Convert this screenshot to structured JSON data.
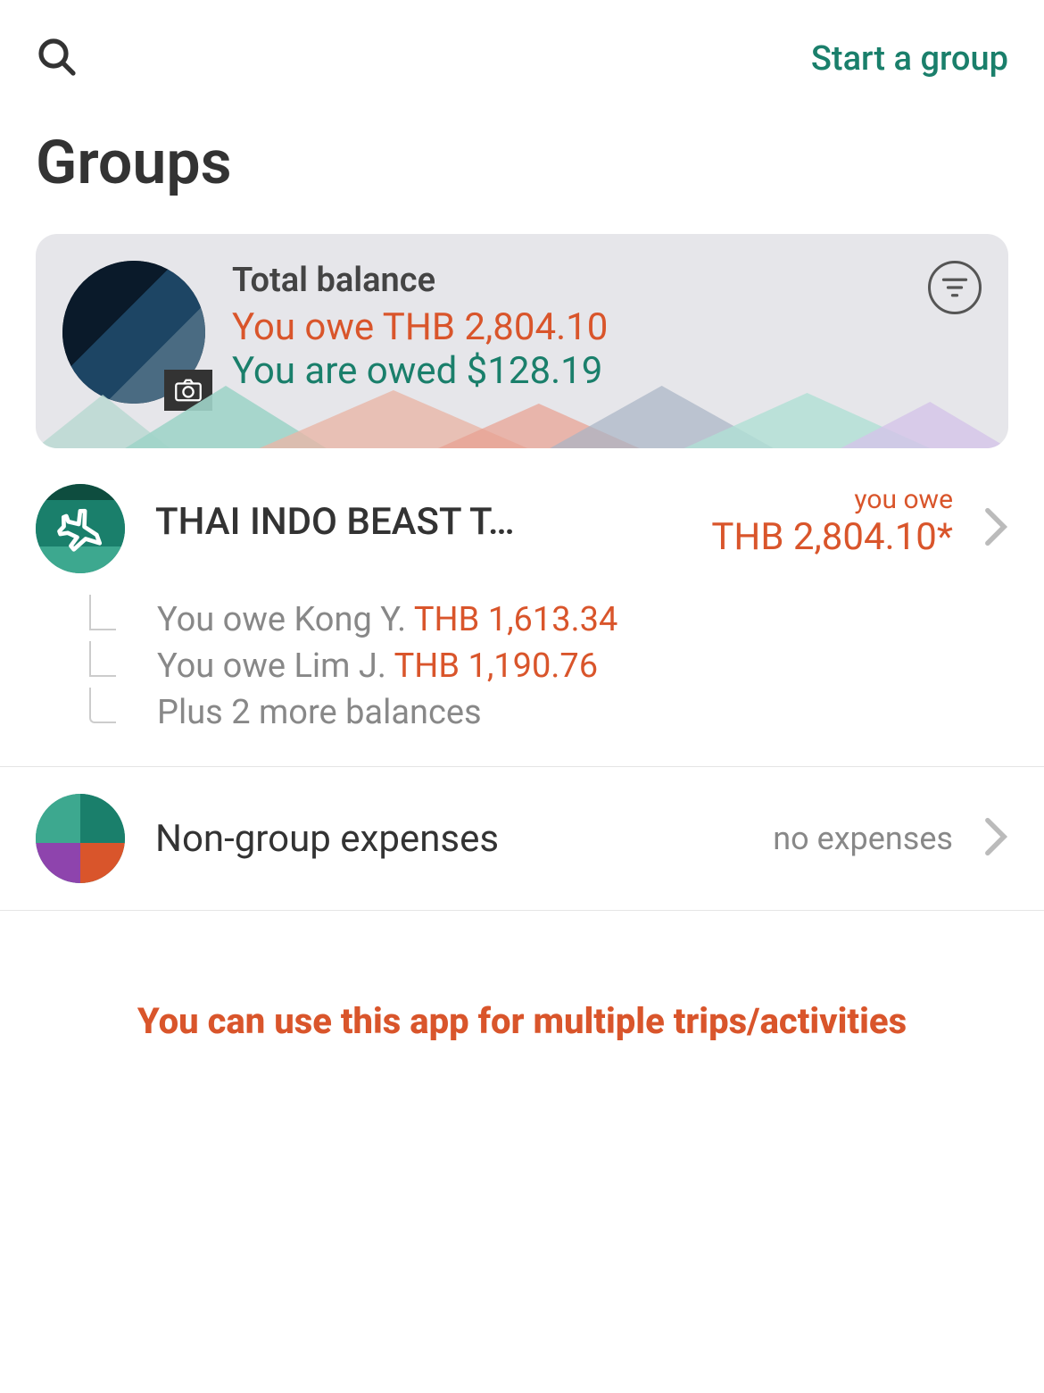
{
  "colors": {
    "owe": "#d9552b",
    "owed": "#1a7f6b",
    "muted": "#888"
  },
  "header": {
    "start_group_label": "Start a group"
  },
  "page_title": "Groups",
  "balance_card": {
    "label": "Total balance",
    "you_owe": "You owe THB 2,804.10",
    "you_are_owed": "You are owed $128.19"
  },
  "groups": [
    {
      "name": "THAI INDO BEAST T…",
      "status_label": "you owe",
      "amount": "THB 2,804.10*",
      "details": [
        {
          "text": "You owe Kong Y. ",
          "amount": "THB 1,613.34"
        },
        {
          "text": "You owe Lim J. ",
          "amount": "THB 1,190.76"
        }
      ],
      "more": "Plus 2 more balances"
    },
    {
      "name": "Non-group expenses",
      "status_label": "no expenses"
    }
  ],
  "promo_text": "You can use this app for multiple trips/activities"
}
